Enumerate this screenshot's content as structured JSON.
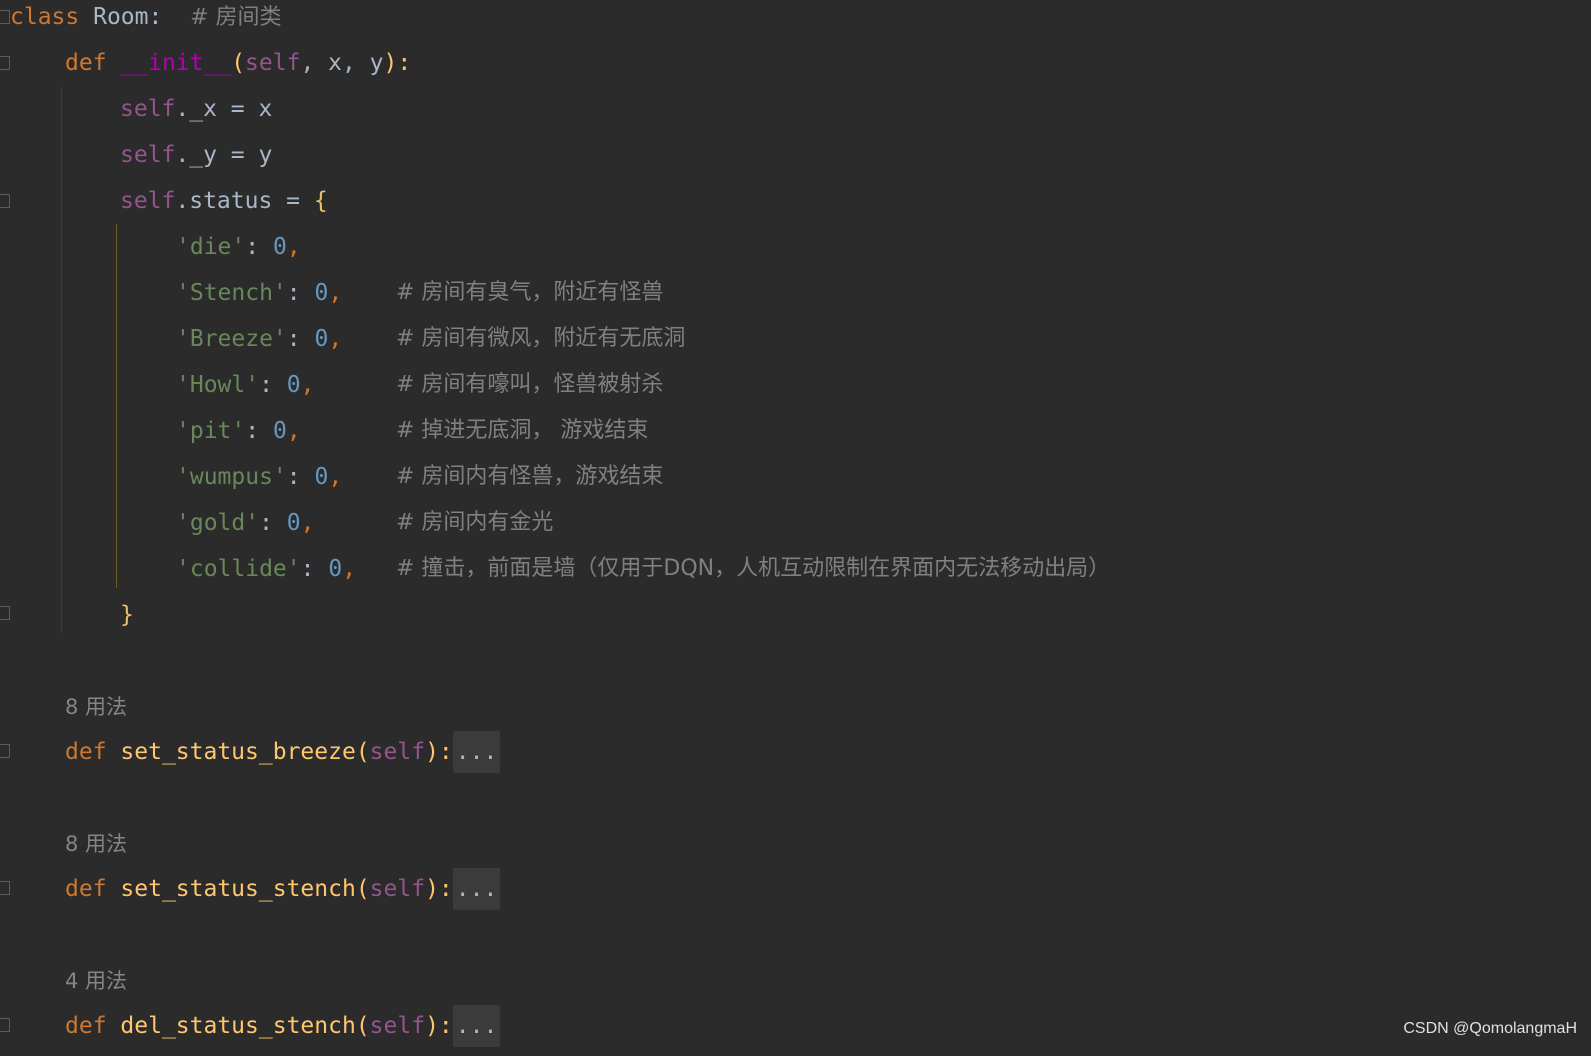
{
  "code": {
    "class_line": {
      "kw": "class",
      "name": "Room:",
      "comment": "# 房间类"
    },
    "init_line": {
      "kw": "def",
      "name": "__init__",
      "open": "(",
      "self": "self",
      "params": ", x, y",
      "close": "):"
    },
    "assign_x": {
      "self": "self",
      "rest": "._x = x"
    },
    "assign_y": {
      "self": "self",
      "rest": "._y = y"
    },
    "status_line": {
      "self": "self",
      "rest": ".status = ",
      "brace": "{"
    },
    "status_items": [
      {
        "key": "'die'",
        "sep": ": ",
        "num": "0",
        "comma": ",",
        "pad": "",
        "comment": ""
      },
      {
        "key": "'Stench'",
        "sep": ": ",
        "num": "0",
        "comma": ",",
        "pad": "    ",
        "comment": "# 房间有臭气，附近有怪兽"
      },
      {
        "key": "'Breeze'",
        "sep": ": ",
        "num": "0",
        "comma": ",",
        "pad": "    ",
        "comment": "# 房间有微风，附近有无底洞"
      },
      {
        "key": "'Howl'",
        "sep": ": ",
        "num": "0",
        "comma": ",",
        "pad": "      ",
        "comment": "# 房间有嚎叫，怪兽被射杀"
      },
      {
        "key": "'pit'",
        "sep": ": ",
        "num": "0",
        "comma": ",",
        "pad": "       ",
        "comment": "# 掉进无底洞， 游戏结束"
      },
      {
        "key": "'wumpus'",
        "sep": ": ",
        "num": "0",
        "comma": ",",
        "pad": "    ",
        "comment": "# 房间内有怪兽，游戏结束"
      },
      {
        "key": "'gold'",
        "sep": ": ",
        "num": "0",
        "comma": ",",
        "pad": "      ",
        "comment": "# 房间内有金光"
      },
      {
        "key": "'collide'",
        "sep": ": ",
        "num": "0",
        "comma": ",",
        "pad": "   ",
        "comment": "# 撞击，前面是墙（仅用于DQN，人机互动限制在界面内无法移动出局）"
      }
    ],
    "close_brace": "}",
    "methods": [
      {
        "usage": "8 用法",
        "kw": "def",
        "name": "set_status_breeze",
        "open": "(",
        "self": "self",
        "close": "):",
        "fold": "..."
      },
      {
        "usage": "8 用法",
        "kw": "def",
        "name": "set_status_stench",
        "open": "(",
        "self": "self",
        "close": "):",
        "fold": "..."
      },
      {
        "usage": "4 用法",
        "kw": "def",
        "name": "del_status_stench",
        "open": "(",
        "self": "self",
        "close": "):",
        "fold": "..."
      }
    ]
  },
  "watermark": "CSDN @QomolangmaH"
}
